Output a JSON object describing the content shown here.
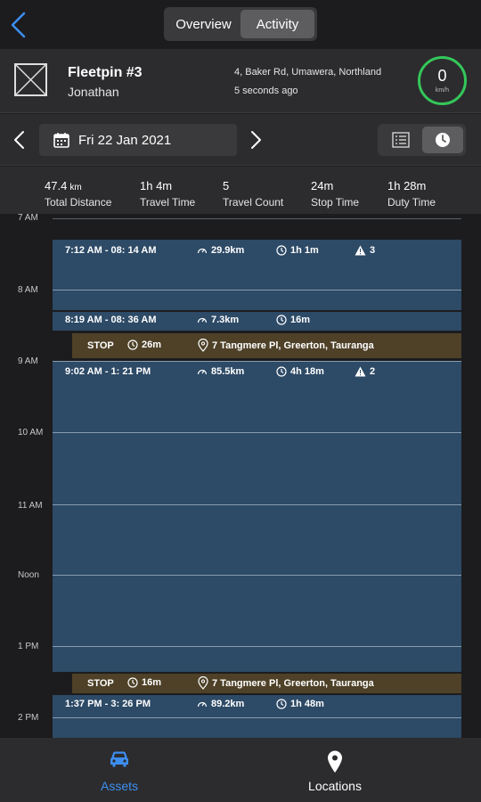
{
  "nav": {
    "tabs": [
      {
        "label": "Overview",
        "active": false
      },
      {
        "label": "Activity",
        "active": true
      }
    ]
  },
  "asset": {
    "name": "Fleetpin #3",
    "driver": "Jonathan",
    "address": "4, Baker Rd, Umawera, Northland",
    "updated": "5 seconds ago",
    "speed": "0",
    "speed_unit": "km/h",
    "speed_color": "#34c759"
  },
  "date_bar": {
    "date": "Fri 22 Jan 2021",
    "view_modes": [
      {
        "icon": "list-icon",
        "active": false
      },
      {
        "icon": "clock-icon",
        "active": true
      }
    ]
  },
  "stats": [
    {
      "value": "47.4",
      "unit": "km",
      "label": "Total Distance"
    },
    {
      "value": "1h 4m",
      "unit": "",
      "label": "Travel Time"
    },
    {
      "value": "5",
      "unit": "",
      "label": "Travel Count"
    },
    {
      "value": "24m",
      "unit": "",
      "label": "Stop Time"
    },
    {
      "value": "1h 28m",
      "unit": "",
      "label": "Duty Time"
    }
  ],
  "timeline": {
    "hours": [
      "7 AM",
      "8 AM",
      "9 AM",
      "10 AM",
      "11 AM",
      "Noon",
      "1 PM",
      "2 PM"
    ],
    "trips": [
      {
        "time": "7:12 AM - 08: 14 AM",
        "distance": "29.9km",
        "duration": "1h 1m",
        "alerts": "3"
      },
      {
        "time": "8:19 AM - 08: 36 AM",
        "distance": "7.3km",
        "duration": "16m",
        "alerts": ""
      },
      {
        "time": "9:02 AM - 1: 21 PM",
        "distance": "85.5km",
        "duration": "4h 18m",
        "alerts": "2"
      },
      {
        "time": "1:37 PM - 3: 26 PM",
        "distance": "89.2km",
        "duration": "1h 48m",
        "alerts": ""
      }
    ],
    "stops": [
      {
        "label": "STOP",
        "duration": "26m",
        "location": "7 Tangmere Pl, Greerton, Tauranga"
      },
      {
        "label": "STOP",
        "duration": "16m",
        "location": "7 Tangmere Pl, Greerton, Tauranga"
      }
    ],
    "colors": {
      "trip": "#2d4a66",
      "stop": "#4e4128"
    }
  },
  "tabbar": {
    "tabs": [
      {
        "label": "Assets",
        "icon": "car-icon",
        "active": true
      },
      {
        "label": "Locations",
        "icon": "location-pin-icon",
        "active": false
      }
    ],
    "accent": "#3d8ef0"
  }
}
